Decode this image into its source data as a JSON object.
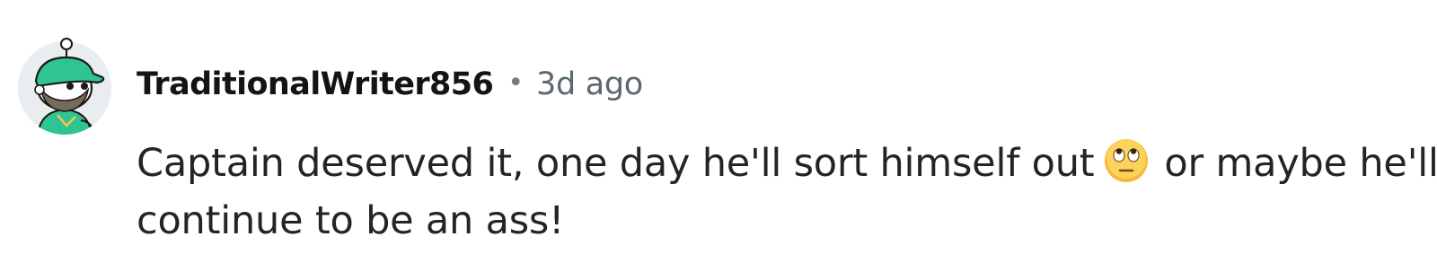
{
  "comment": {
    "username": "TraditionalWriter856",
    "separator": "•",
    "timestamp": "3d ago",
    "body": {
      "line1_before_emoji": "Captain deserved it, one day he'll sort himself out",
      "emoji": "face-with-rolling-eyes",
      "line1_after_emoji": "or maybe he'll",
      "line2": "continue to be an ass!"
    },
    "avatar": {
      "icon": "snoo-avatar-icon",
      "bg_color": "#e9edf0",
      "cap_color": "#2ec592",
      "shirt_color": "#2ec592"
    }
  }
}
